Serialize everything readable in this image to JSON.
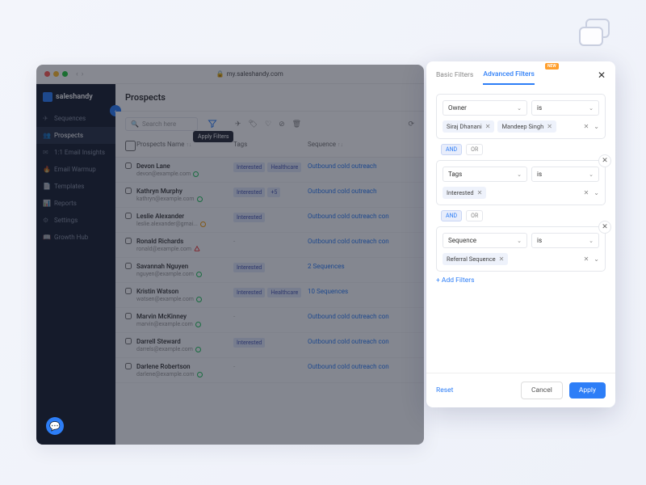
{
  "browser": {
    "url": "my.saleshandy.com"
  },
  "brand": "saleshandy",
  "sidebar": {
    "items": [
      {
        "label": "Sequences"
      },
      {
        "label": "Prospects",
        "active": true
      },
      {
        "label": "1:1 Email Insights"
      },
      {
        "label": "Email Warmup"
      },
      {
        "label": "Templates"
      },
      {
        "label": "Reports"
      },
      {
        "label": "Settings"
      },
      {
        "label": "Growth Hub"
      }
    ]
  },
  "page": {
    "title": "Prospects",
    "search_placeholder": "Search here",
    "tooltip": "Apply Filters"
  },
  "columns": {
    "name": "Prospects Name",
    "tags": "Tags",
    "sequence": "Sequence"
  },
  "rows": [
    {
      "name": "Devon Lane",
      "email": "devon@example.com",
      "status": "green",
      "tags": [
        "Interested",
        "Healthcare"
      ],
      "seq": "Outbound cold outreach"
    },
    {
      "name": "Kathryn Murphy",
      "email": "kathryn@example.com",
      "status": "green",
      "tags": [
        "Interested",
        "+5"
      ],
      "seq": "Outbound cold outreach"
    },
    {
      "name": "Leslie Alexander",
      "email": "leslie.alexander@gmai...",
      "status": "orange",
      "tags": [
        "Interested"
      ],
      "seq": "Outbound cold outreach con"
    },
    {
      "name": "Ronald Richards",
      "email": "ronald@example.com",
      "status": "red",
      "tags": [
        "-"
      ],
      "seq": "Outbound cold outreach con"
    },
    {
      "name": "Savannah Nguyen",
      "email": "nguyen@example.com",
      "status": "green",
      "tags": [
        "Interested"
      ],
      "seq": "2 Sequences"
    },
    {
      "name": "Kristin Watson",
      "email": "watsen@example.com",
      "status": "green",
      "tags": [
        "Interested",
        "Healthcare"
      ],
      "seq": "10 Sequences"
    },
    {
      "name": "Marvin McKinney",
      "email": "marvin@example.com",
      "status": "green",
      "tags": [
        "-"
      ],
      "seq": "Outbound cold outreach con"
    },
    {
      "name": "Darrell Steward",
      "email": "darrels@example.com",
      "status": "green",
      "tags": [
        "Interested"
      ],
      "seq": "Outbound cold outreach con"
    },
    {
      "name": "Darlene Robertson",
      "email": "darlene@example.com",
      "status": "green",
      "tags": [
        "-"
      ],
      "seq": "Outbound cold outreach con"
    }
  ],
  "panel": {
    "tab_basic": "Basic Filters",
    "tab_advanced": "Advanced Filters",
    "new_badge": "NEW",
    "groups": [
      {
        "field": "Owner",
        "op": "is",
        "chips": [
          "Siraj Dhanani",
          "Mandeep Singh"
        ],
        "closable": false
      },
      {
        "field": "Tags",
        "op": "is",
        "chips": [
          "Interested"
        ],
        "closable": true
      },
      {
        "field": "Sequence",
        "op": "is",
        "chips": [
          "Referral Sequence"
        ],
        "closable": true
      }
    ],
    "connector_and": "AND",
    "connector_or": "OR",
    "add": "+ Add Filters",
    "reset": "Reset",
    "cancel": "Cancel",
    "apply": "Apply"
  }
}
